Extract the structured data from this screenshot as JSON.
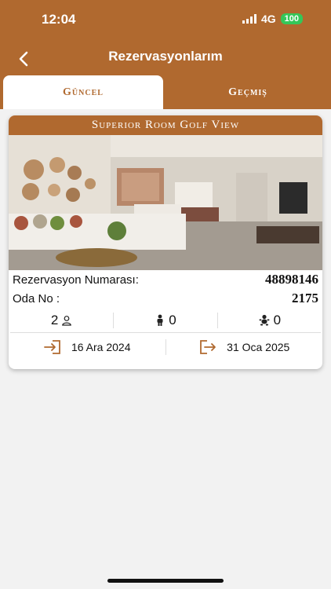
{
  "status_bar": {
    "time": "12:04",
    "network": "4G",
    "battery": "100"
  },
  "header": {
    "title": "Rezervasyonlarım",
    "back_icon": "chevron-left-icon"
  },
  "tabs": [
    {
      "label": "Güncel",
      "active": true
    },
    {
      "label": "Geçmiş",
      "active": false
    }
  ],
  "reservation": {
    "room_title": "Superior Room Golf View",
    "reservation_label": "Rezervasyon Numarası:",
    "reservation_number": "48898146",
    "room_label": "Oda No :",
    "room_number": "2175",
    "adults": "2",
    "children": "0",
    "babies": "0",
    "check_in": "16 Ara 2024",
    "check_out": "31 Oca 2025"
  },
  "colors": {
    "brand": "#b0692f",
    "background": "#f2f2f2",
    "battery": "#34c759"
  }
}
